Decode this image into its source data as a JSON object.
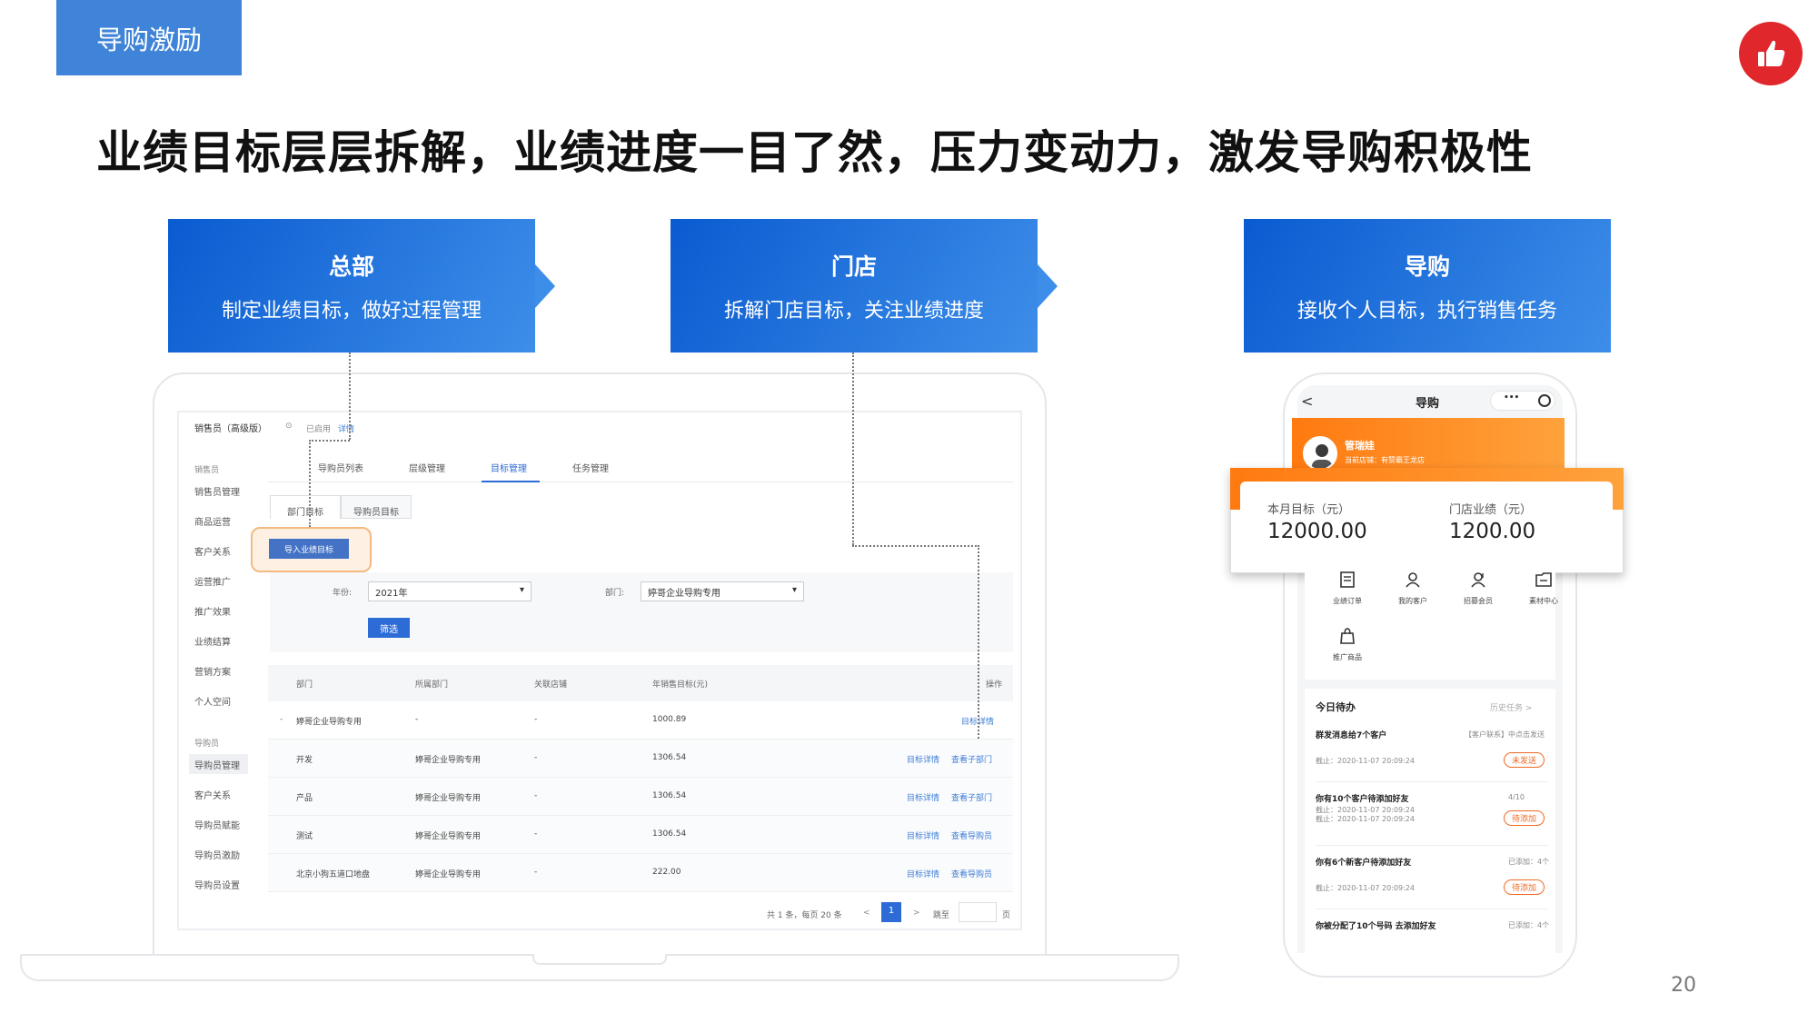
{
  "tag": "导购激励",
  "headline": "业绩目标层层拆解，业绩进度一目了然，压力变动力，激发导购积极性",
  "cards": [
    {
      "title": "总部",
      "subtitle": "制定业绩目标，做好过程管理"
    },
    {
      "title": "门店",
      "subtitle": "拆解门店目标，关注业绩进度"
    },
    {
      "title": "导购",
      "subtitle": "接收个人目标，执行销售任务"
    }
  ],
  "admin": {
    "app_title": "销售员（高级版）",
    "status": "已启用",
    "status_link": "详情",
    "sidebar_group1": "销售员",
    "sidebar1": [
      "销售员管理",
      "商品运营",
      "客户关系",
      "运营推广",
      "推广效果",
      "业绩结算",
      "营销方案",
      "个人空间"
    ],
    "sidebar_group2": "导购员",
    "sidebar2": [
      "导购员管理",
      "客户关系",
      "导购员赋能",
      "导购员激励",
      "导购员设置"
    ],
    "tabs": [
      "导购员列表",
      "层级管理",
      "目标管理",
      "任务管理"
    ],
    "subtabs": [
      "部门目标",
      "导购员目标"
    ],
    "import_button": "导入业绩目标",
    "year_label": "年份:",
    "year_value": "2021年",
    "dept_label": "部门:",
    "dept_value": "婷哥企业导购专用",
    "filter_button": "筛选",
    "columns": [
      "部门",
      "所属部门",
      "关联店铺",
      "年销售目标(元)",
      "操作"
    ],
    "rows": [
      {
        "dept": "婷哥企业导购专用",
        "parent": "-",
        "store": "-",
        "target": "1000.89",
        "action1": "目标详情",
        "action2": ""
      },
      {
        "dept": "开发",
        "parent": "婷哥企业导购专用",
        "store": "-",
        "target": "1306.54",
        "action1": "目标详情",
        "action2": "查看子部门"
      },
      {
        "dept": "产品",
        "parent": "婷哥企业导购专用",
        "store": "-",
        "target": "1306.54",
        "action1": "目标详情",
        "action2": "查看子部门"
      },
      {
        "dept": "测试",
        "parent": "婷哥企业导购专用",
        "store": "-",
        "target": "1306.54",
        "action1": "目标详情",
        "action2": "查看导购员"
      },
      {
        "dept": "北京小狗五道口地盘",
        "parent": "婷哥企业导购专用",
        "store": "-",
        "target": "222.00",
        "action1": "目标详情",
        "action2": "查看导购员"
      }
    ],
    "expand_symbol": "-",
    "pager_summary": "共 1 条，每页 20 条",
    "pager_prev": "<",
    "pager_page": "1",
    "pager_next": ">",
    "pager_jump": "跳至",
    "pager_unit": "页"
  },
  "phone": {
    "title": "导购",
    "back": "<",
    "menu": "•••",
    "user_name": "管瑞娃",
    "user_store": "当前店铺：有赞霸王龙店",
    "month_target_label": "本月目标（元）",
    "month_target_value": "12000.00",
    "store_perf_label": "门店业绩（元）",
    "store_perf_value": "1200.00",
    "icons": [
      "业绩订单",
      "我的客户",
      "招募会员",
      "素材中心",
      "推广商品"
    ],
    "todo_title": "今日待办",
    "todo_history": "历史任务 >",
    "todos": [
      {
        "title": "群发消息给7个客户",
        "meta": "【客户联系】中点击发送",
        "deadline": "截止：2020-11-07 20:09:24",
        "action": "未发送"
      },
      {
        "title": "你有10个客户待添加好友",
        "meta": "4/10",
        "deadline": "截止：2020-11-07 20:09:24",
        "deadline2": "截止：2020-11-07 20:09:24",
        "action": "待添加"
      },
      {
        "title": "你有6个新客户待添加好友",
        "meta": "已添加：4个",
        "deadline": "截止：2020-11-07 20:09:24",
        "action": "待添加"
      },
      {
        "title": "你被分配了10个号码 去添加好友",
        "meta": "已添加：4个",
        "deadline": "",
        "action": ""
      }
    ]
  },
  "page_number": "20",
  "colors": {
    "accent": "#3f84d8",
    "card_start": "#0a5bd0",
    "card_end": "#3d8ee9",
    "orange": "#ff7a10",
    "thumb": "#e0282c",
    "highlight": "#f3b981"
  }
}
